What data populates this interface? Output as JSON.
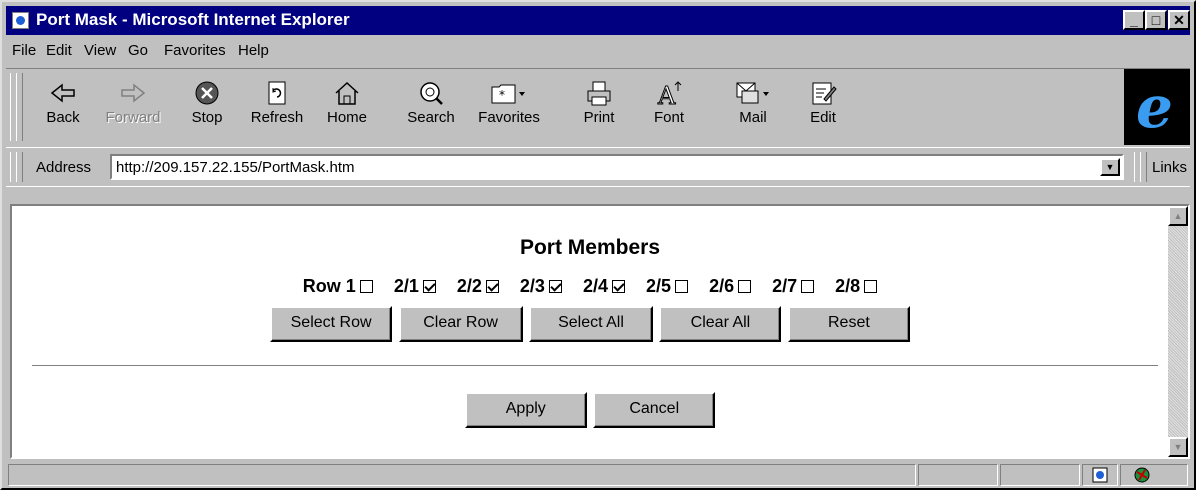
{
  "window": {
    "title": "Port Mask - Microsoft Internet Explorer"
  },
  "menu": [
    "File",
    "Edit",
    "View",
    "Go",
    "Favorites",
    "Help"
  ],
  "toolbar": {
    "back": "Back",
    "forward": "Forward",
    "stop": "Stop",
    "refresh": "Refresh",
    "home": "Home",
    "search": "Search",
    "favorites": "Favorites",
    "print": "Print",
    "font": "Font",
    "mail": "Mail",
    "edit": "Edit"
  },
  "address": {
    "label": "Address",
    "url": "http://209.157.22.155/PortMask.htm",
    "links": "Links"
  },
  "page": {
    "heading": "Port Members",
    "row_label": "Row 1",
    "ports": [
      {
        "label": "2/1",
        "checked": true
      },
      {
        "label": "2/2",
        "checked": true
      },
      {
        "label": "2/3",
        "checked": true
      },
      {
        "label": "2/4",
        "checked": true
      },
      {
        "label": "2/5",
        "checked": false
      },
      {
        "label": "2/6",
        "checked": false
      },
      {
        "label": "2/7",
        "checked": false
      },
      {
        "label": "2/8",
        "checked": false
      }
    ],
    "buttons": {
      "select_row": "Select Row",
      "clear_row": "Clear Row",
      "select_all": "Select All",
      "clear_all": "Clear All",
      "reset": "Reset"
    },
    "apply": "Apply",
    "cancel": "Cancel"
  }
}
